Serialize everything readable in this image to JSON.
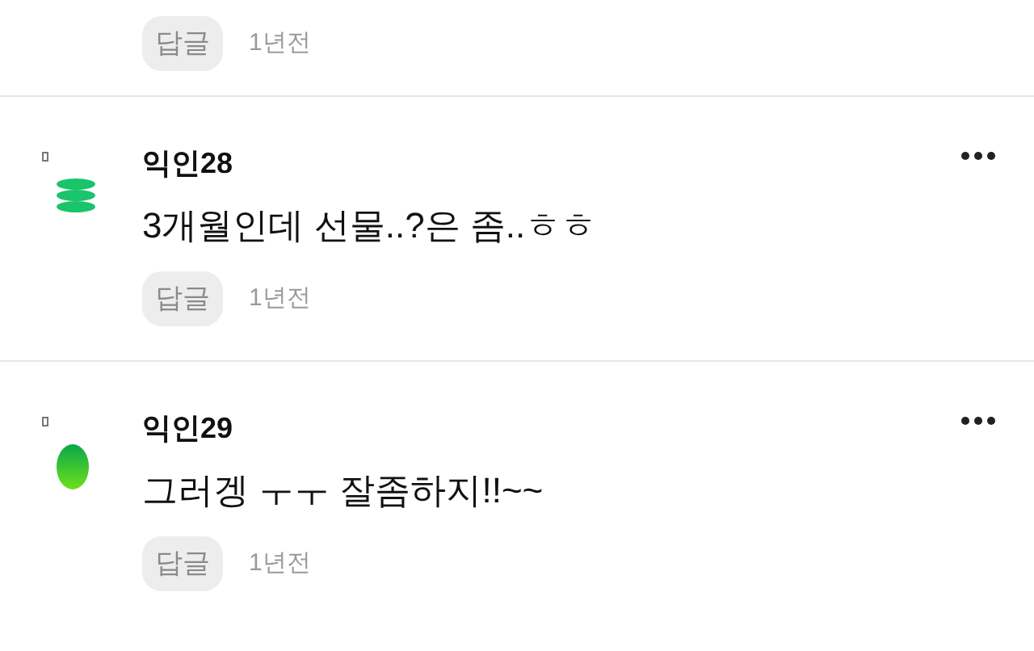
{
  "previous_comment": {
    "reply_button": "답글",
    "time": "1년전"
  },
  "comments": [
    {
      "kind": "stack",
      "name": "익인28",
      "text": "3개월인데 선물..?은 좀..ㅎㅎ",
      "reply_button": "답글",
      "time": "1년전"
    },
    {
      "kind": "blob",
      "name": "익인29",
      "text": "그러겡 ㅜㅜ 잘좀하지!!~~",
      "reply_button": "답글",
      "time": "1년전"
    }
  ]
}
